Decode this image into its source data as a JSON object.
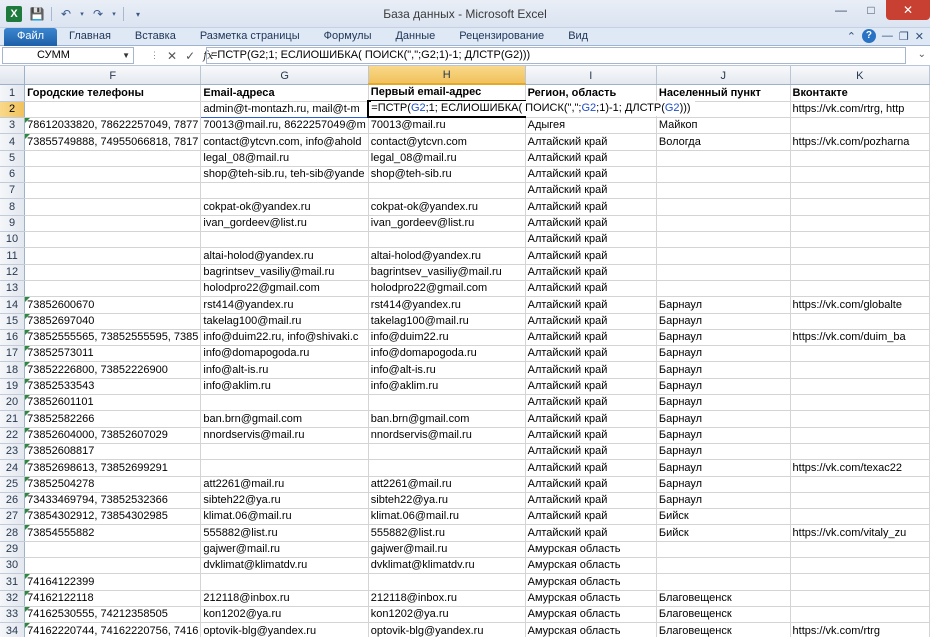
{
  "window": {
    "title": "База данных  -  Microsoft Excel",
    "app_icon": "X"
  },
  "ribbon": {
    "tabs": [
      "Файл",
      "Главная",
      "Вставка",
      "Разметка страницы",
      "Формулы",
      "Данные",
      "Рецензирование",
      "Вид"
    ]
  },
  "formula_bar": {
    "name_box": "СУММ",
    "fx": "fx",
    "formula": "=ПСТР(G2;1; ЕСЛИОШИБКА( ПОИСК(\",\";G2;1)-1; ДЛСТР(G2)))"
  },
  "editing": {
    "p1": "=ПСТР(",
    "r1": "G2",
    "p2": ";1; ЕСЛИОШИБКА( ПОИСК(\",\";",
    "r2": "G2",
    "p3": ";1)-1; ДЛСТР(",
    "r3": "G2",
    "p4": ")))"
  },
  "columns": [
    "F",
    "G",
    "H",
    "I",
    "J",
    "K"
  ],
  "rows": [
    {
      "n": "1",
      "F": "Городские телефоны",
      "G": "Email-адреса",
      "H": "Первый email-адрес",
      "I": "Регион, область",
      "J": "Населенный пункт",
      "K": "Вконтакте"
    },
    {
      "n": "2",
      "F": "",
      "G": "admin@t-montazh.ru, mail@t-m",
      "H": "",
      "I": "",
      "J": "",
      "K": "https://vk.com/rtrg, http"
    },
    {
      "n": "3",
      "F": "78612033820, 78622257049, 7877",
      "G": "70013@mail.ru, 8622257049@m",
      "H": "70013@mail.ru",
      "I": "Адыгея",
      "J": "Майкоп",
      "K": ""
    },
    {
      "n": "4",
      "F": "73855749888, 74955066818, 7817",
      "G": "contact@ytcvn.com, info@ahold",
      "H": "contact@ytcvn.com",
      "I": "Алтайский край",
      "J": "Вологда",
      "K": "https://vk.com/pozharna"
    },
    {
      "n": "5",
      "F": "",
      "G": "legal_08@mail.ru",
      "H": "legal_08@mail.ru",
      "I": "Алтайский край",
      "J": "",
      "K": ""
    },
    {
      "n": "6",
      "F": "",
      "G": "shop@teh-sib.ru, teh-sib@yande",
      "H": "shop@teh-sib.ru",
      "I": "Алтайский край",
      "J": "",
      "K": ""
    },
    {
      "n": "7",
      "F": "",
      "G": "",
      "H": "",
      "I": "Алтайский край",
      "J": "",
      "K": ""
    },
    {
      "n": "8",
      "F": "",
      "G": "cokpat-ok@yandex.ru",
      "H": "cokpat-ok@yandex.ru",
      "I": "Алтайский край",
      "J": "",
      "K": ""
    },
    {
      "n": "9",
      "F": "",
      "G": "ivan_gordeev@list.ru",
      "H": "ivan_gordeev@list.ru",
      "I": "Алтайский край",
      "J": "",
      "K": ""
    },
    {
      "n": "10",
      "F": "",
      "G": "",
      "H": "",
      "I": "Алтайский край",
      "J": "",
      "K": ""
    },
    {
      "n": "11",
      "F": "",
      "G": "altai-holod@yandex.ru",
      "H": "altai-holod@yandex.ru",
      "I": "Алтайский край",
      "J": "",
      "K": ""
    },
    {
      "n": "12",
      "F": "",
      "G": "bagrintsev_vasiliy@mail.ru",
      "H": "bagrintsev_vasiliy@mail.ru",
      "I": "Алтайский край",
      "J": "",
      "K": ""
    },
    {
      "n": "13",
      "F": "",
      "G": "holodpro22@gmail.com",
      "H": "holodpro22@gmail.com",
      "I": "Алтайский край",
      "J": "",
      "K": ""
    },
    {
      "n": "14",
      "F": "73852600670",
      "G": "rst414@yandex.ru",
      "H": "rst414@yandex.ru",
      "I": "Алтайский край",
      "J": "Барнаул",
      "K": "https://vk.com/globalte"
    },
    {
      "n": "15",
      "F": "73852697040",
      "G": "takelag100@mail.ru",
      "H": "takelag100@mail.ru",
      "I": "Алтайский край",
      "J": "Барнаул",
      "K": ""
    },
    {
      "n": "16",
      "F": "73852555565, 73852555595, 7385",
      "G": "info@duim22.ru, info@shivaki.c",
      "H": "info@duim22.ru",
      "I": "Алтайский край",
      "J": "Барнаул",
      "K": "https://vk.com/duim_ba"
    },
    {
      "n": "17",
      "F": "73852573011",
      "G": "info@domapogoda.ru",
      "H": "info@domapogoda.ru",
      "I": "Алтайский край",
      "J": "Барнаул",
      "K": ""
    },
    {
      "n": "18",
      "F": "73852226800, 73852226900",
      "G": "info@alt-is.ru",
      "H": "info@alt-is.ru",
      "I": "Алтайский край",
      "J": "Барнаул",
      "K": ""
    },
    {
      "n": "19",
      "F": "73852533543",
      "G": "info@aklim.ru",
      "H": "info@aklim.ru",
      "I": "Алтайский край",
      "J": "Барнаул",
      "K": ""
    },
    {
      "n": "20",
      "F": "73852601101",
      "G": "",
      "H": "",
      "I": "Алтайский край",
      "J": "Барнаул",
      "K": ""
    },
    {
      "n": "21",
      "F": "73852582266",
      "G": "ban.brn@gmail.com",
      "H": "ban.brn@gmail.com",
      "I": "Алтайский край",
      "J": "Барнаул",
      "K": ""
    },
    {
      "n": "22",
      "F": "73852604000, 73852607029",
      "G": "nnordservis@mail.ru",
      "H": "nnordservis@mail.ru",
      "I": "Алтайский край",
      "J": "Барнаул",
      "K": ""
    },
    {
      "n": "23",
      "F": "73852608817",
      "G": "",
      "H": "",
      "I": "Алтайский край",
      "J": "Барнаул",
      "K": ""
    },
    {
      "n": "24",
      "F": "73852698613, 73852699291",
      "G": "",
      "H": "",
      "I": "Алтайский край",
      "J": "Барнаул",
      "K": "https://vk.com/texac22"
    },
    {
      "n": "25",
      "F": "73852504278",
      "G": "att2261@mail.ru",
      "H": "att2261@mail.ru",
      "I": "Алтайский край",
      "J": "Барнаул",
      "K": ""
    },
    {
      "n": "26",
      "F": "73433469794, 73852532366",
      "G": "sibteh22@ya.ru",
      "H": "sibteh22@ya.ru",
      "I": "Алтайский край",
      "J": "Барнаул",
      "K": ""
    },
    {
      "n": "27",
      "F": "73854302912, 73854302985",
      "G": "klimat.06@mail.ru",
      "H": "klimat.06@mail.ru",
      "I": "Алтайский край",
      "J": "Бийск",
      "K": ""
    },
    {
      "n": "28",
      "F": "73854555882",
      "G": "555882@list.ru",
      "H": "555882@list.ru",
      "I": "Алтайский край",
      "J": "Бийск",
      "K": "https://vk.com/vitaly_zu"
    },
    {
      "n": "29",
      "F": "",
      "G": "gajwer@mail.ru",
      "H": "gajwer@mail.ru",
      "I": "Амурская область",
      "J": "",
      "K": ""
    },
    {
      "n": "30",
      "F": "",
      "G": "dvklimat@klimatdv.ru",
      "H": "dvklimat@klimatdv.ru",
      "I": "Амурская область",
      "J": "",
      "K": ""
    },
    {
      "n": "31",
      "F": "74164122399",
      "G": "",
      "H": "",
      "I": "Амурская область",
      "J": "",
      "K": ""
    },
    {
      "n": "32",
      "F": "74162122118",
      "G": "212118@inbox.ru",
      "H": "212118@inbox.ru",
      "I": "Амурская область",
      "J": "Благовещенск",
      "K": ""
    },
    {
      "n": "33",
      "F": "74162530555, 74212358505",
      "G": "kon1202@ya.ru",
      "H": "kon1202@ya.ru",
      "I": "Амурская область",
      "J": "Благовещенск",
      "K": ""
    },
    {
      "n": "34",
      "F": "74162220744, 74162220756, 7416",
      "G": "optovik-blg@yandex.ru",
      "H": "optovik-blg@yandex.ru",
      "I": "Амурская область",
      "J": "Благовещенск",
      "K": "https://vk.com/rtrg"
    }
  ]
}
